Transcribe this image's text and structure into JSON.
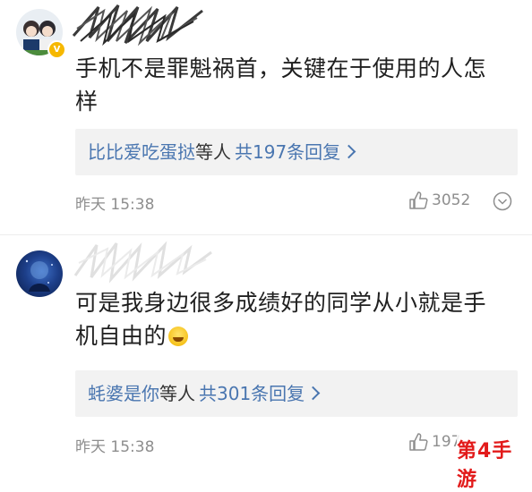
{
  "comments": [
    {
      "text": "手机不是罪魁祸首，关键在于使用的人怎样",
      "replies": {
        "user": "比比爱吃蛋挞",
        "mid": "等人",
        "total": "共197条回复"
      },
      "time": "昨天 15:38",
      "likes": "3052"
    },
    {
      "text": "可是我身边很多成绩好的同学从小就是手机自由的",
      "replies": {
        "user": "蚝婆是你",
        "mid": "等人",
        "total": "共301条回复"
      },
      "time": "昨天 15:38",
      "likes": "197"
    }
  ],
  "watermark": "第4手游",
  "colors": {
    "link": "#4a76b0",
    "meta": "#8e8e8e",
    "watermark": "#e21a1a",
    "badge": "#f6b800"
  }
}
